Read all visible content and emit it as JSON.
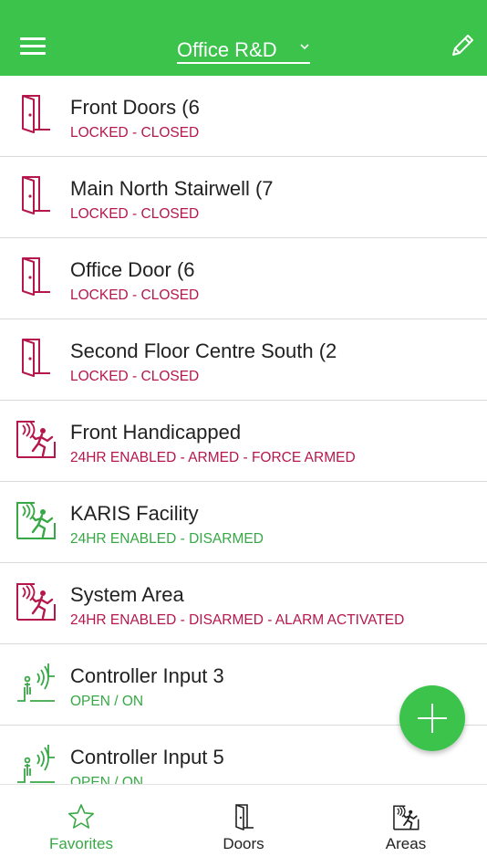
{
  "header": {
    "site_name": "Office R&D"
  },
  "colors": {
    "brand_green": "#3cc34c",
    "status_red": "#b5174b",
    "status_green": "#37a845"
  },
  "items": [
    {
      "title": "Front Doors (6",
      "status": "LOCKED - CLOSED",
      "icon": "door-icon",
      "tone": "red"
    },
    {
      "title": "Main North Stairwell (7",
      "status": "LOCKED - CLOSED",
      "icon": "door-icon",
      "tone": "red"
    },
    {
      "title": "Office Door (6",
      "status": "LOCKED - CLOSED",
      "icon": "door-icon",
      "tone": "red"
    },
    {
      "title": "Second Floor Centre South (2",
      "status": "LOCKED - CLOSED",
      "icon": "door-icon",
      "tone": "red"
    },
    {
      "title": "Front Handicapped",
      "status": "24HR ENABLED - ARMED - FORCE ARMED",
      "icon": "intruder-area-icon",
      "tone": "red"
    },
    {
      "title": "KARIS Facility",
      "status": "24HR ENABLED - DISARMED",
      "icon": "intruder-area-icon",
      "tone": "green"
    },
    {
      "title": "System Area",
      "status": "24HR ENABLED - DISARMED - ALARM ACTIVATED",
      "icon": "intruder-area-icon",
      "tone": "red"
    },
    {
      "title": "Controller Input 3",
      "status": "OPEN / ON",
      "icon": "motion-sensor-icon",
      "tone": "green"
    },
    {
      "title": "Controller Input 5",
      "status": "OPEN / ON",
      "icon": "motion-sensor-icon",
      "tone": "green"
    }
  ],
  "tabs": [
    {
      "label": "Favorites",
      "icon": "star-icon",
      "active": true
    },
    {
      "label": "Doors",
      "icon": "door-icon",
      "active": false
    },
    {
      "label": "Areas",
      "icon": "intruder-area-icon",
      "active": false
    }
  ]
}
